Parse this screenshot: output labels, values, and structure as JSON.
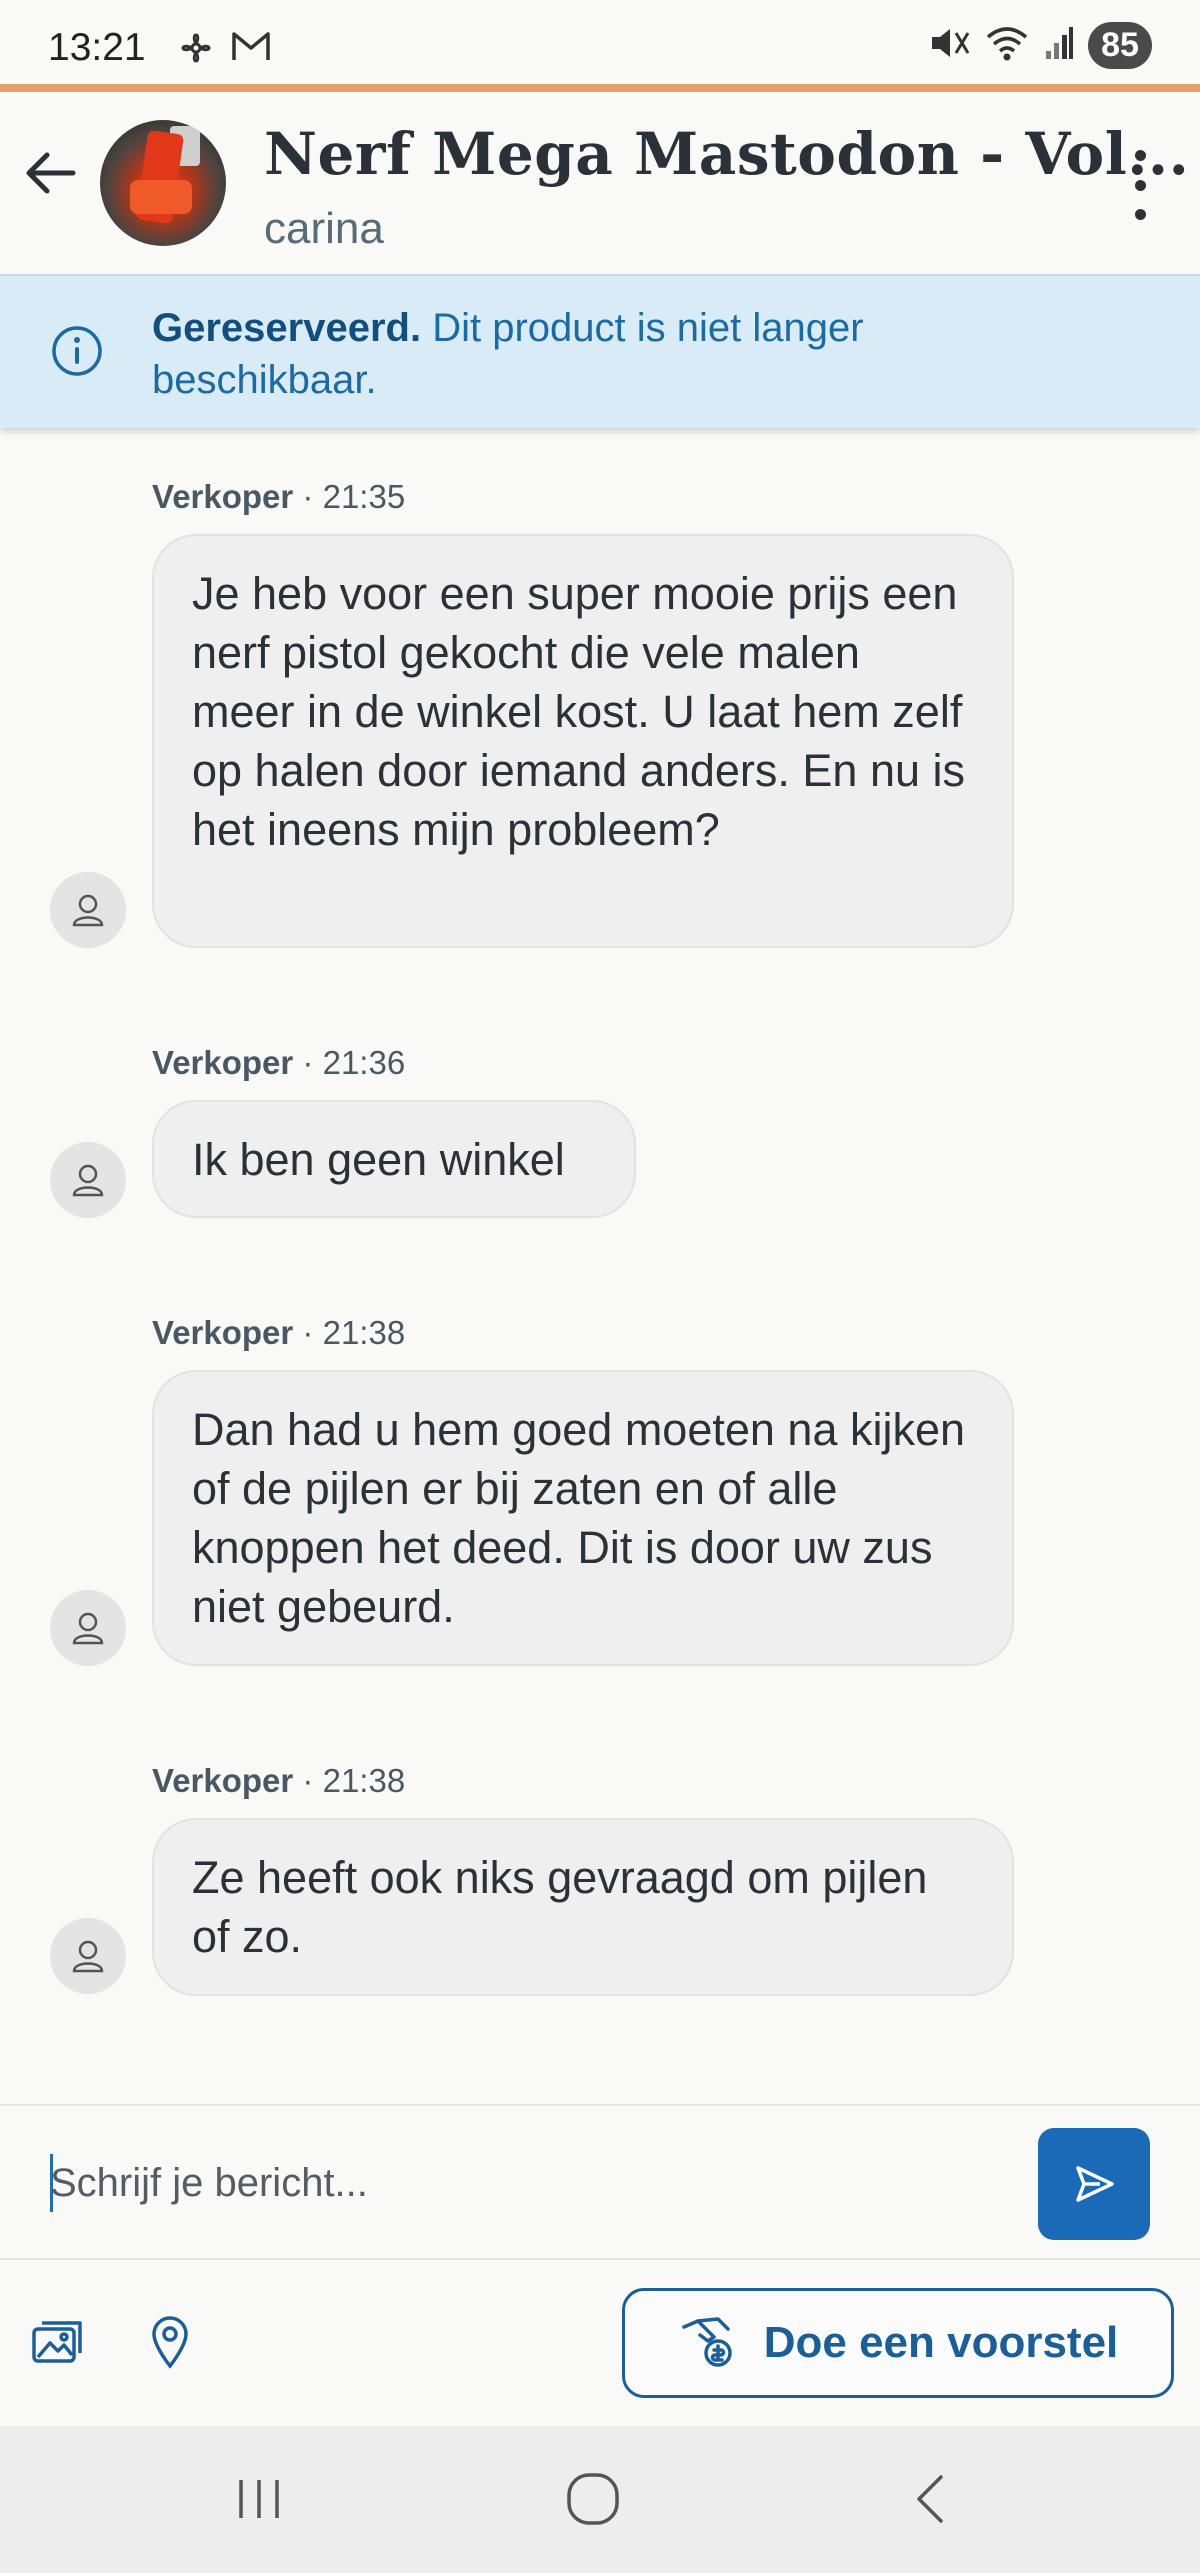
{
  "status_bar": {
    "time": "13:21",
    "left_icons": [
      "fan-icon",
      "gmail-icon"
    ],
    "right_icons": [
      "mute-icon",
      "wifi-icon",
      "signal-icon"
    ],
    "battery": "85"
  },
  "header": {
    "title": "Nerf Mega Mastodon - Vol...",
    "subtitle": "carina"
  },
  "banner": {
    "status": "Gereserveerd.",
    "message": "Dit product is niet langer beschikbaar."
  },
  "messages": [
    {
      "sender": "Verkoper",
      "time": "21:35",
      "text": "Je heb voor een super mooie prijs een nerf pistol gekocht die vele malen meer in de winkel kost. U laat hem zelf op halen door iemand anders. En nu is het ineens mijn probleem?"
    },
    {
      "sender": "Verkoper",
      "time": "21:36",
      "text": "Ik ben geen winkel"
    },
    {
      "sender": "Verkoper",
      "time": "21:38",
      "text": "Dan had u hem goed moeten na kijken of de pijlen er bij zaten en of alle knoppen het deed. Dit is door uw zus niet gebeurd."
    },
    {
      "sender": "Verkoper",
      "time": "21:38",
      "text": "Ze heeft ook niks gevraagd om pijlen of zo."
    }
  ],
  "meta_separator": "·",
  "composer": {
    "placeholder": "Schrijf je bericht..."
  },
  "tools": {
    "offer_label": "Doe een voorstel"
  },
  "colors": {
    "accent": "#e3a067",
    "primary": "#1b6ab8",
    "banner_bg": "#d9ebf7",
    "bubble_bg": "#efefef"
  }
}
